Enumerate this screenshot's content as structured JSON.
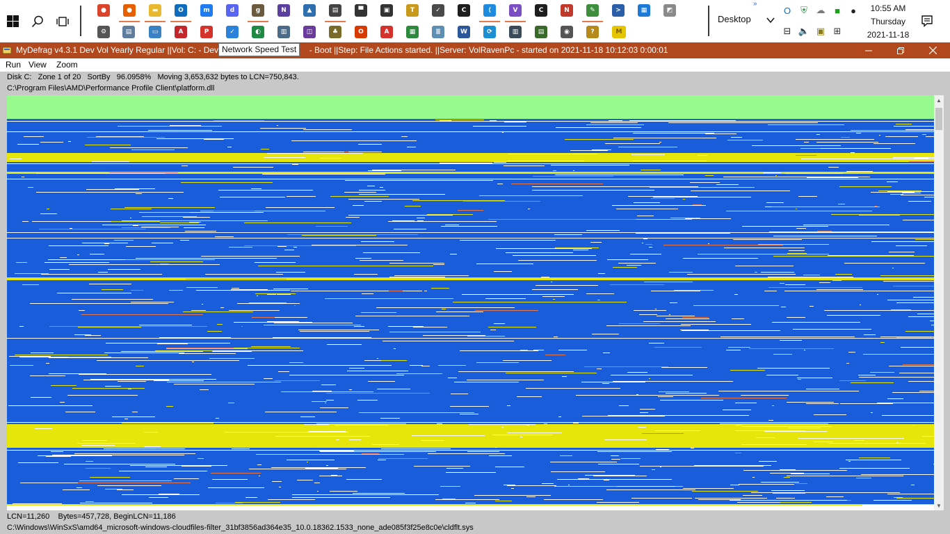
{
  "taskbar": {
    "start_icon": "windows-logo-icon",
    "search_icon": "search-icon",
    "task_view_icon": "task-view-icon",
    "desktop_toolbar_label": "Desktop",
    "overflow_label": "»",
    "apps_row1": [
      {
        "name": "chrome",
        "color": "#d9442b",
        "glyph": "●"
      },
      {
        "name": "firefox",
        "color": "#e66000",
        "glyph": "●"
      },
      {
        "name": "file-explorer",
        "color": "#e8b830",
        "glyph": "▬"
      },
      {
        "name": "outlook",
        "color": "#0f6cbd",
        "glyph": "O"
      },
      {
        "name": "messenger",
        "color": "#1e7bf2",
        "glyph": "m"
      },
      {
        "name": "discord",
        "color": "#5865f2",
        "glyph": "d"
      },
      {
        "name": "gimp",
        "color": "#6b5a3e",
        "glyph": "g"
      },
      {
        "name": "onenote-like",
        "color": "#5b3fa0",
        "glyph": "N"
      },
      {
        "name": "photos",
        "color": "#2f6fb0",
        "glyph": "▲"
      },
      {
        "name": "scanner",
        "color": "#444444",
        "glyph": "▤"
      },
      {
        "name": "terminal-hat",
        "color": "#333333",
        "glyph": "▀"
      },
      {
        "name": "printer",
        "color": "#333333",
        "glyph": "▣"
      },
      {
        "name": "task-app",
        "color": "#c79a1b",
        "glyph": "T"
      },
      {
        "name": "clock-check",
        "color": "#4a4a4a",
        "glyph": "✓"
      },
      {
        "name": "command-prompt",
        "color": "#1e1e1e",
        "glyph": "C"
      },
      {
        "name": "vs-code",
        "color": "#1d8ce0",
        "glyph": "⟨"
      },
      {
        "name": "visual-studio",
        "color": "#7a4fc4",
        "glyph": "V"
      },
      {
        "name": "cmd-admin",
        "color": "#1e1e1e",
        "glyph": "C"
      },
      {
        "name": "red-tool",
        "color": "#c0392b",
        "glyph": "N"
      },
      {
        "name": "paint-tool",
        "color": "#3e8e3e",
        "glyph": "✎"
      },
      {
        "name": "powershell",
        "color": "#2b5ea8",
        "glyph": ">"
      },
      {
        "name": "grid-tool",
        "color": "#1e7ad6",
        "glyph": "▦"
      },
      {
        "name": "image-viewer",
        "color": "#8a8a8a",
        "glyph": "◩"
      }
    ],
    "apps_row2": [
      {
        "name": "settings",
        "color": "#555555",
        "glyph": "⚙"
      },
      {
        "name": "computer-management",
        "color": "#5f7d9e",
        "glyph": "▤"
      },
      {
        "name": "id-card",
        "color": "#3b82c4",
        "glyph": "▭"
      },
      {
        "name": "acrobat-like",
        "color": "#c3272b",
        "glyph": "A"
      },
      {
        "name": "pdf-tool",
        "color": "#d4322c",
        "glyph": "P"
      },
      {
        "name": "todo",
        "color": "#2a82da",
        "glyph": "✓"
      },
      {
        "name": "green-app",
        "color": "#1e8a44",
        "glyph": "◐"
      },
      {
        "name": "disk-cleanup",
        "color": "#4a6a8a",
        "glyph": "▥"
      },
      {
        "name": "purple-app",
        "color": "#6a3b9c",
        "glyph": "◫"
      },
      {
        "name": "tree-app",
        "color": "#7a6a2a",
        "glyph": "♣"
      },
      {
        "name": "office",
        "color": "#d83b01",
        "glyph": "O"
      },
      {
        "name": "adobe-reader",
        "color": "#d4322c",
        "glyph": "A"
      },
      {
        "name": "green-grid",
        "color": "#2c8a3c",
        "glyph": "▦"
      },
      {
        "name": "scroll-app",
        "color": "#5d8fb5",
        "glyph": "≣"
      },
      {
        "name": "word",
        "color": "#2b579a",
        "glyph": "W"
      },
      {
        "name": "connect-app",
        "color": "#1b8fd4",
        "glyph": "⟳"
      },
      {
        "name": "barcode-tool",
        "color": "#3a4a5a",
        "glyph": "▥"
      },
      {
        "name": "chart-tool",
        "color": "#3a6a2a",
        "glyph": "▤"
      },
      {
        "name": "camera-tool",
        "color": "#555555",
        "glyph": "◉"
      },
      {
        "name": "help-tool",
        "color": "#b58a1a",
        "glyph": "?"
      },
      {
        "name": "mydefrag",
        "color": "#e5c400",
        "glyph": "M"
      }
    ],
    "tray_row1": [
      {
        "name": "outlook-tray-icon",
        "color": "#0f6cbd",
        "glyph": "O"
      },
      {
        "name": "shield-tray-icon",
        "color": "#2e9c4a",
        "glyph": "⛨"
      },
      {
        "name": "onedrive-cloud-icon",
        "color": "#7a7a7a",
        "glyph": "☁"
      },
      {
        "name": "green-square-icon",
        "color": "#1aa01a",
        "glyph": "■"
      },
      {
        "name": "microphone-icon",
        "color": "#222222",
        "glyph": "●"
      }
    ],
    "tray_row2": [
      {
        "name": "network-icon",
        "color": "#222222",
        "glyph": "⊟"
      },
      {
        "name": "volume-icon",
        "color": "#222222",
        "glyph": "🔈"
      },
      {
        "name": "clipboard-tray-icon",
        "color": "#8a7a1a",
        "glyph": "▣"
      },
      {
        "name": "printer-tray-icon",
        "color": "#333333",
        "glyph": "⊞"
      }
    ],
    "clock": {
      "time": "10:55 AM",
      "day": "Thursday",
      "date": "2021-11-18"
    },
    "notification_icon": "notification-icon"
  },
  "tooltip": "Network Speed Test",
  "window": {
    "title": "MyDefrag v4.3.1   Dev Vol Yearly Regular ||Vol: C: - Deve",
    "title_rest": "- Boot ||Step: File Actions started. ||Server: VolRavenPc -  started on 2021-11-18 10:12:03 0:00:01",
    "controls": {
      "minimize": "minimize-icon",
      "restore": "restore-icon",
      "close": "close-icon"
    },
    "menu": [
      "Run",
      "View",
      "Zoom"
    ],
    "status_top_1": "Disk C:   Zone 1 of 20   SortBy   96.0958%   Moving 3,653,632 bytes to LCN=750,843.",
    "status_top_2": "C:\\Program Files\\AMD\\Performance Profile Client\\platform.dll",
    "status_bottom_1": "LCN=11,260    Bytes=457,728, BeginLCN=11,186",
    "status_bottom_2": "C:\\Windows\\WinSxS\\amd64_microsoft-windows-cloudfiles-filter_31bf3856ad364e35_10.0.18362.1533_none_ade085f3f25e8c0e\\cldflt.sys"
  },
  "diskmap_colors": {
    "background": "#1a5ddb",
    "free_space": "#ffffff",
    "mft_zone": "#98f98e",
    "sorted_zone": "#e6e60a",
    "busy": "#e8784a"
  }
}
